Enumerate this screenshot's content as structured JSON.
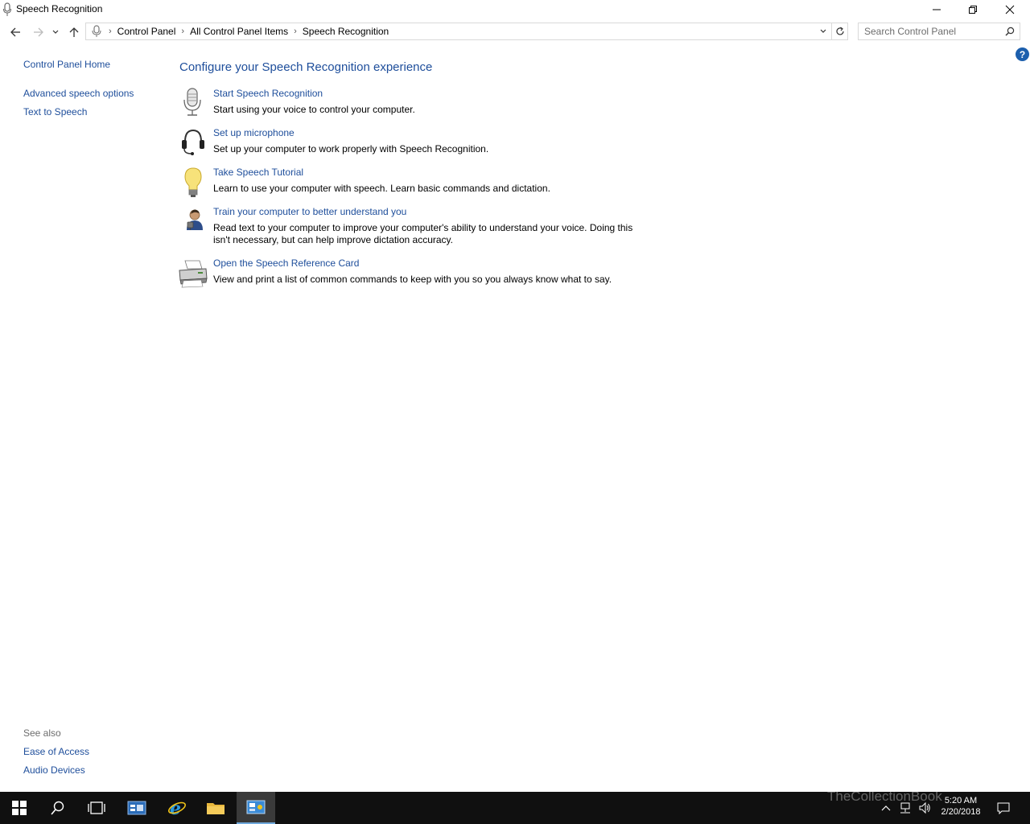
{
  "window": {
    "title": "Speech Recognition",
    "minimize_icon": "minimize-icon",
    "maximize_icon": "restore-icon",
    "close_icon": "close-icon"
  },
  "address": {
    "breadcrumbs": [
      "Control Panel",
      "All Control Panel Items",
      "Speech Recognition"
    ],
    "search_placeholder": "Search Control Panel"
  },
  "leftnav": {
    "home": "Control Panel Home",
    "items": [
      "Advanced speech options",
      "Text to Speech"
    ]
  },
  "seealso": {
    "header": "See also",
    "items": [
      "Ease of Access",
      "Audio Devices"
    ]
  },
  "main": {
    "title": "Configure your Speech Recognition experience",
    "tasks": [
      {
        "label": "Start Speech Recognition",
        "desc": "Start using your voice to control your computer.",
        "icon": "microphone-icon"
      },
      {
        "label": "Set up microphone",
        "desc": "Set up your computer to work properly with Speech Recognition.",
        "icon": "headset-icon"
      },
      {
        "label": "Take Speech Tutorial",
        "desc": "Learn to use your computer with speech.  Learn basic commands and dictation.",
        "icon": "lightbulb-icon"
      },
      {
        "label": "Train your computer to better understand you",
        "desc": "Read text to your computer to improve your computer's ability to understand your voice.  Doing this isn't necessary, but can help improve dictation accuracy.",
        "icon": "person-icon"
      },
      {
        "label": "Open the Speech Reference Card",
        "desc": "View and print a list of common commands to keep with you so you always know what to say.",
        "icon": "printer-icon"
      }
    ]
  },
  "help_label": "?",
  "taskbar": {
    "time": "5:20 AM",
    "date": "2/20/2018",
    "watermark": "TheCollectionBook"
  },
  "colors": {
    "link": "#1e4e9b",
    "taskbar": "#101010",
    "help": "#1c5fad"
  }
}
